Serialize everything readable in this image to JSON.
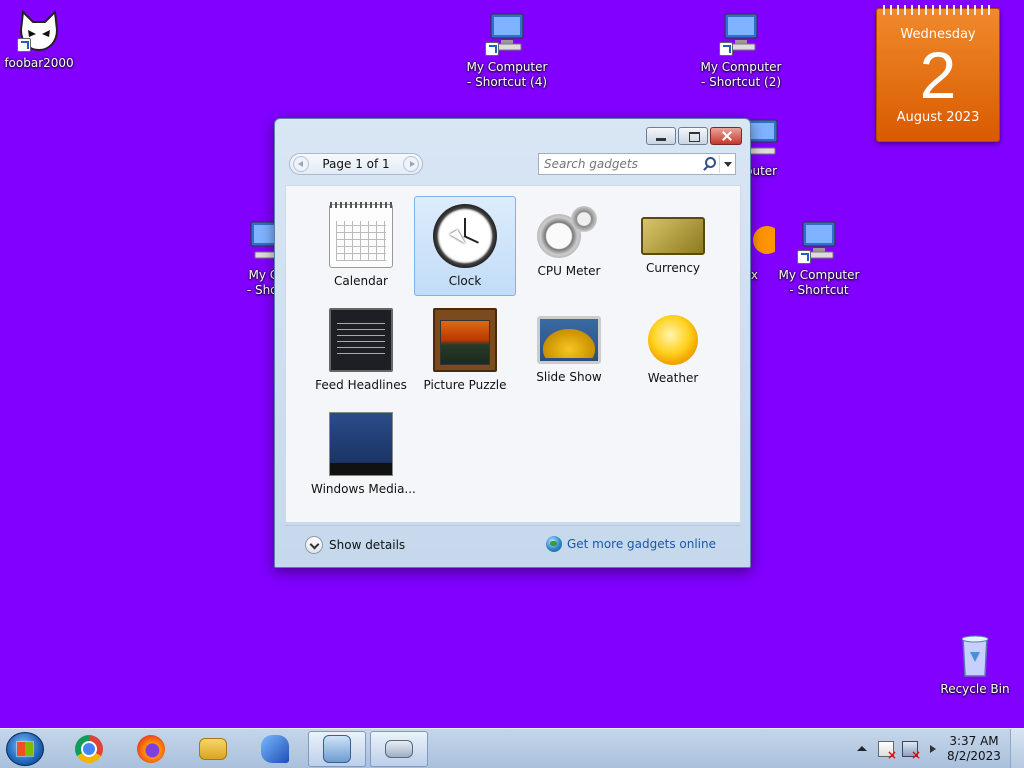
{
  "desktop": {
    "icons": [
      {
        "label": "foobar2000"
      },
      {
        "label": "My Computer\n- Shortcut (4)"
      },
      {
        "label": "My Computer\n- Shortcut (2)"
      },
      {
        "label": "My Co\n- Short"
      },
      {
        "label": "My Computer\n- Shortcut"
      },
      {
        "label": "puter"
      },
      {
        "label": "ox"
      },
      {
        "label": "Recycle Bin"
      }
    ]
  },
  "calendar_gadget": {
    "weekday": "Wednesday",
    "day": "2",
    "month_year": "August 2023"
  },
  "gadget_window": {
    "pager_label": "Page 1 of 1",
    "search_placeholder": "Search gadgets",
    "gadgets": [
      {
        "name": "Calendar",
        "icon": "calendar-icon"
      },
      {
        "name": "Clock",
        "icon": "clock-icon",
        "selected": true
      },
      {
        "name": "CPU Meter",
        "icon": "cpu-meter-icon"
      },
      {
        "name": "Currency",
        "icon": "currency-icon"
      },
      {
        "name": "Feed Headlines",
        "icon": "feed-headlines-icon"
      },
      {
        "name": "Picture Puzzle",
        "icon": "picture-puzzle-icon"
      },
      {
        "name": "Slide Show",
        "icon": "slide-show-icon"
      },
      {
        "name": "Weather",
        "icon": "weather-icon"
      },
      {
        "name": "Windows Media...",
        "icon": "windows-media-center-icon"
      }
    ],
    "show_details_label": "Show details",
    "more_gadgets_label": "Get more gadgets online"
  },
  "taskbar": {
    "items": [
      "start-orb",
      "chrome",
      "firefox",
      "file-explorer",
      "blue-app",
      "gadgets",
      "on-screen-keyboard"
    ],
    "clock_time": "3:37 AM",
    "clock_date": "8/2/2023"
  },
  "colors": {
    "desktop_background": "#8100ff",
    "calendar_orange": "#e8701a",
    "link_blue": "#1a57a8"
  }
}
